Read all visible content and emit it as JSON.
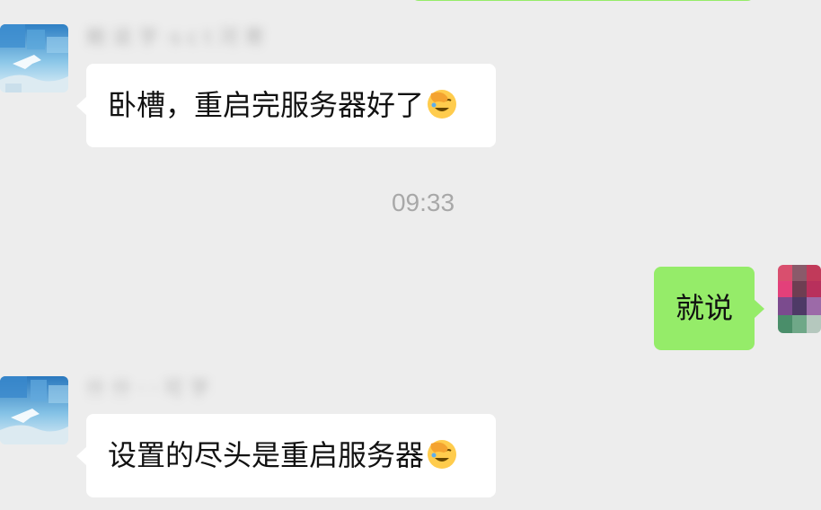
{
  "chat": {
    "timestamp": "09:33",
    "messages": [
      {
        "side": "left",
        "sender": "鲍 说 字 ·s c t 河 寄",
        "text": "卧槽，重启完服务器好了",
        "emoji": "facepalm-emoji"
      },
      {
        "side": "right",
        "text": "就说"
      },
      {
        "side": "left",
        "sender": "什 什 · · 可 字",
        "text": "设置的尽头是重启服务器",
        "emoji": "facepalm-emoji"
      }
    ]
  },
  "colors": {
    "background": "#EDEDED",
    "bubble_other": "#FFFFFF",
    "bubble_self": "#95EC69",
    "timestamp": "#A8A8A8"
  }
}
